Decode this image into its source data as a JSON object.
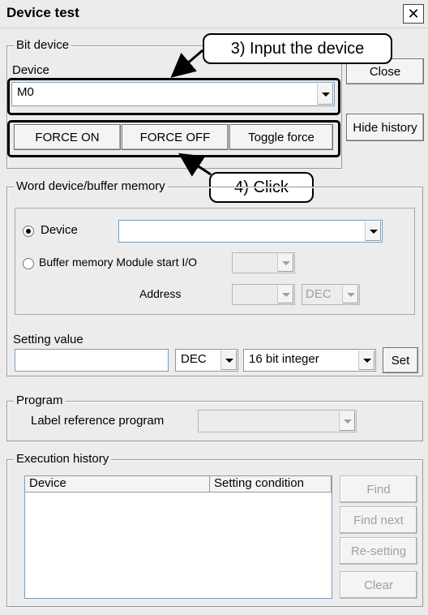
{
  "window": {
    "title": "Device test"
  },
  "bit_device": {
    "group_label": "Bit device",
    "device_label": "Device",
    "device_value": "M0",
    "force_on": "FORCE ON",
    "force_off": "FORCE OFF",
    "toggle_force": "Toggle force"
  },
  "side_buttons": {
    "close": "Close",
    "hide_history": "Hide history"
  },
  "callouts": {
    "input_device": "3) Input the device",
    "click": "4) Click"
  },
  "word_device": {
    "group_label": "Word device/buffer memory",
    "device_radio": "Device",
    "device_value": "",
    "buffer_radio": "Buffer memory Module start I/O",
    "address_label": "Address",
    "address_format": "DEC"
  },
  "setting": {
    "label": "Setting value",
    "value": "",
    "format": "DEC",
    "type": "16 bit integer",
    "set_button": "Set"
  },
  "program": {
    "group_label": "Program",
    "label_ref": "Label reference program",
    "value": ""
  },
  "history": {
    "group_label": "Execution history",
    "columns": [
      "Device",
      "Setting condition"
    ],
    "find": "Find",
    "find_next": "Find next",
    "resetting": "Re-setting",
    "clear": "Clear"
  },
  "icons": {
    "close": "close-icon",
    "dropdown": "chevron-down-icon",
    "arrow": "arrow-icon"
  }
}
